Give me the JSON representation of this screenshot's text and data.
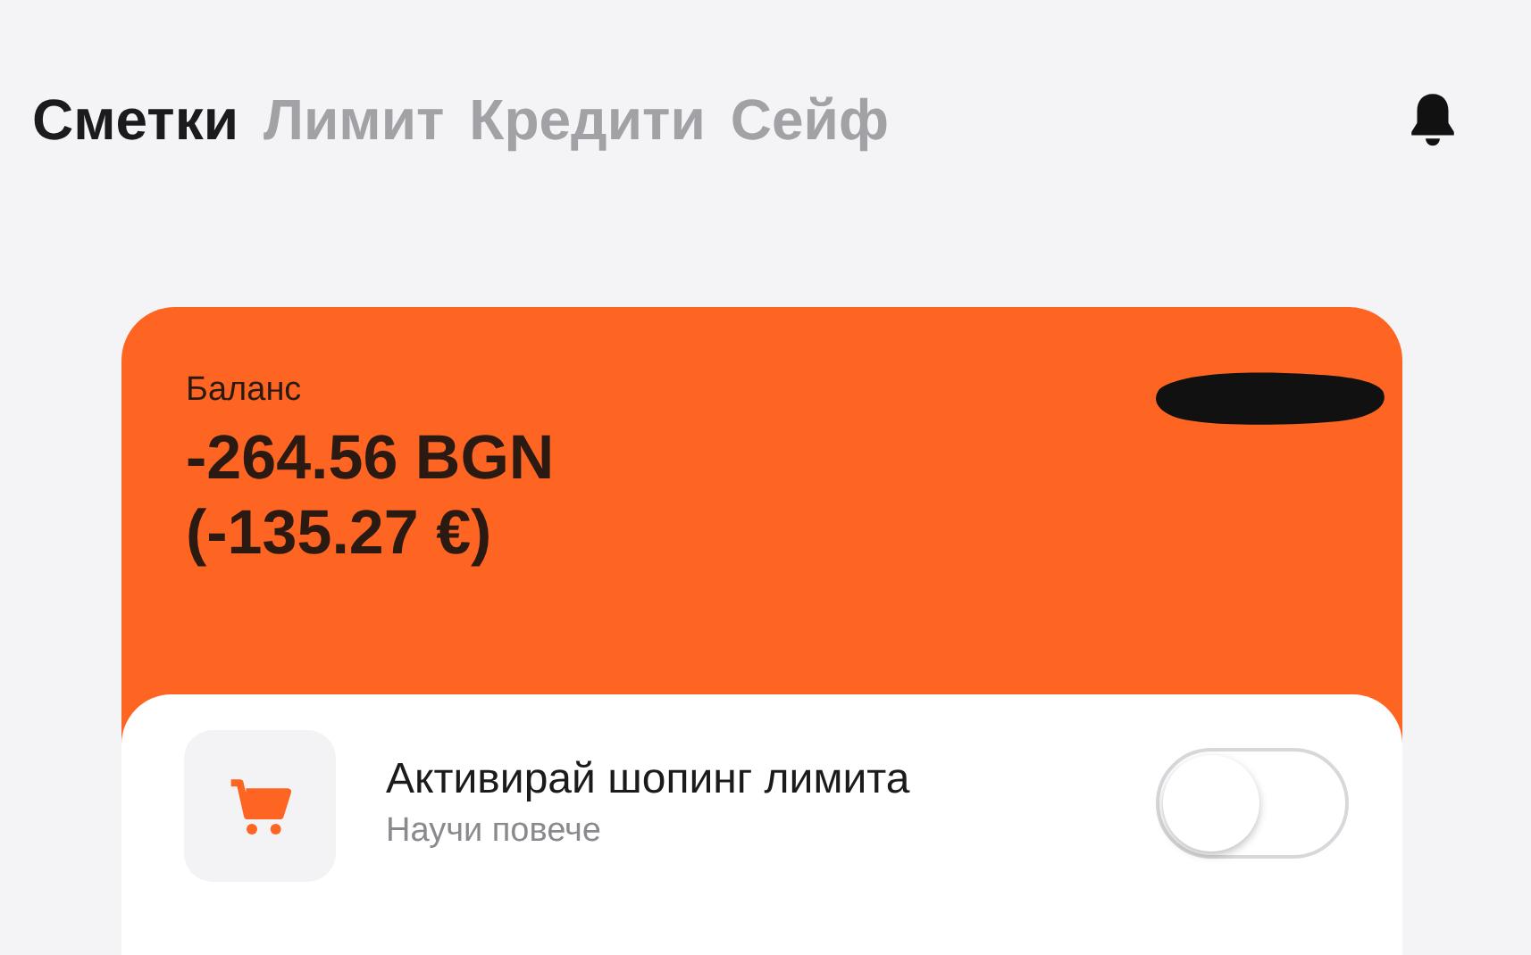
{
  "tabs": [
    {
      "label": "Сметки",
      "selected": true
    },
    {
      "label": "Лимит",
      "selected": false
    },
    {
      "label": "Кредити",
      "selected": false
    },
    {
      "label": "Сейф",
      "selected": false
    }
  ],
  "account_card": {
    "balance_label": "Баланс",
    "balance": "-264.56 BGN",
    "balance_eur": "(-135.27 €)"
  },
  "promo": {
    "title": "Активирай шопинг лимита",
    "link": "Научи повече",
    "toggle_on": false
  }
}
